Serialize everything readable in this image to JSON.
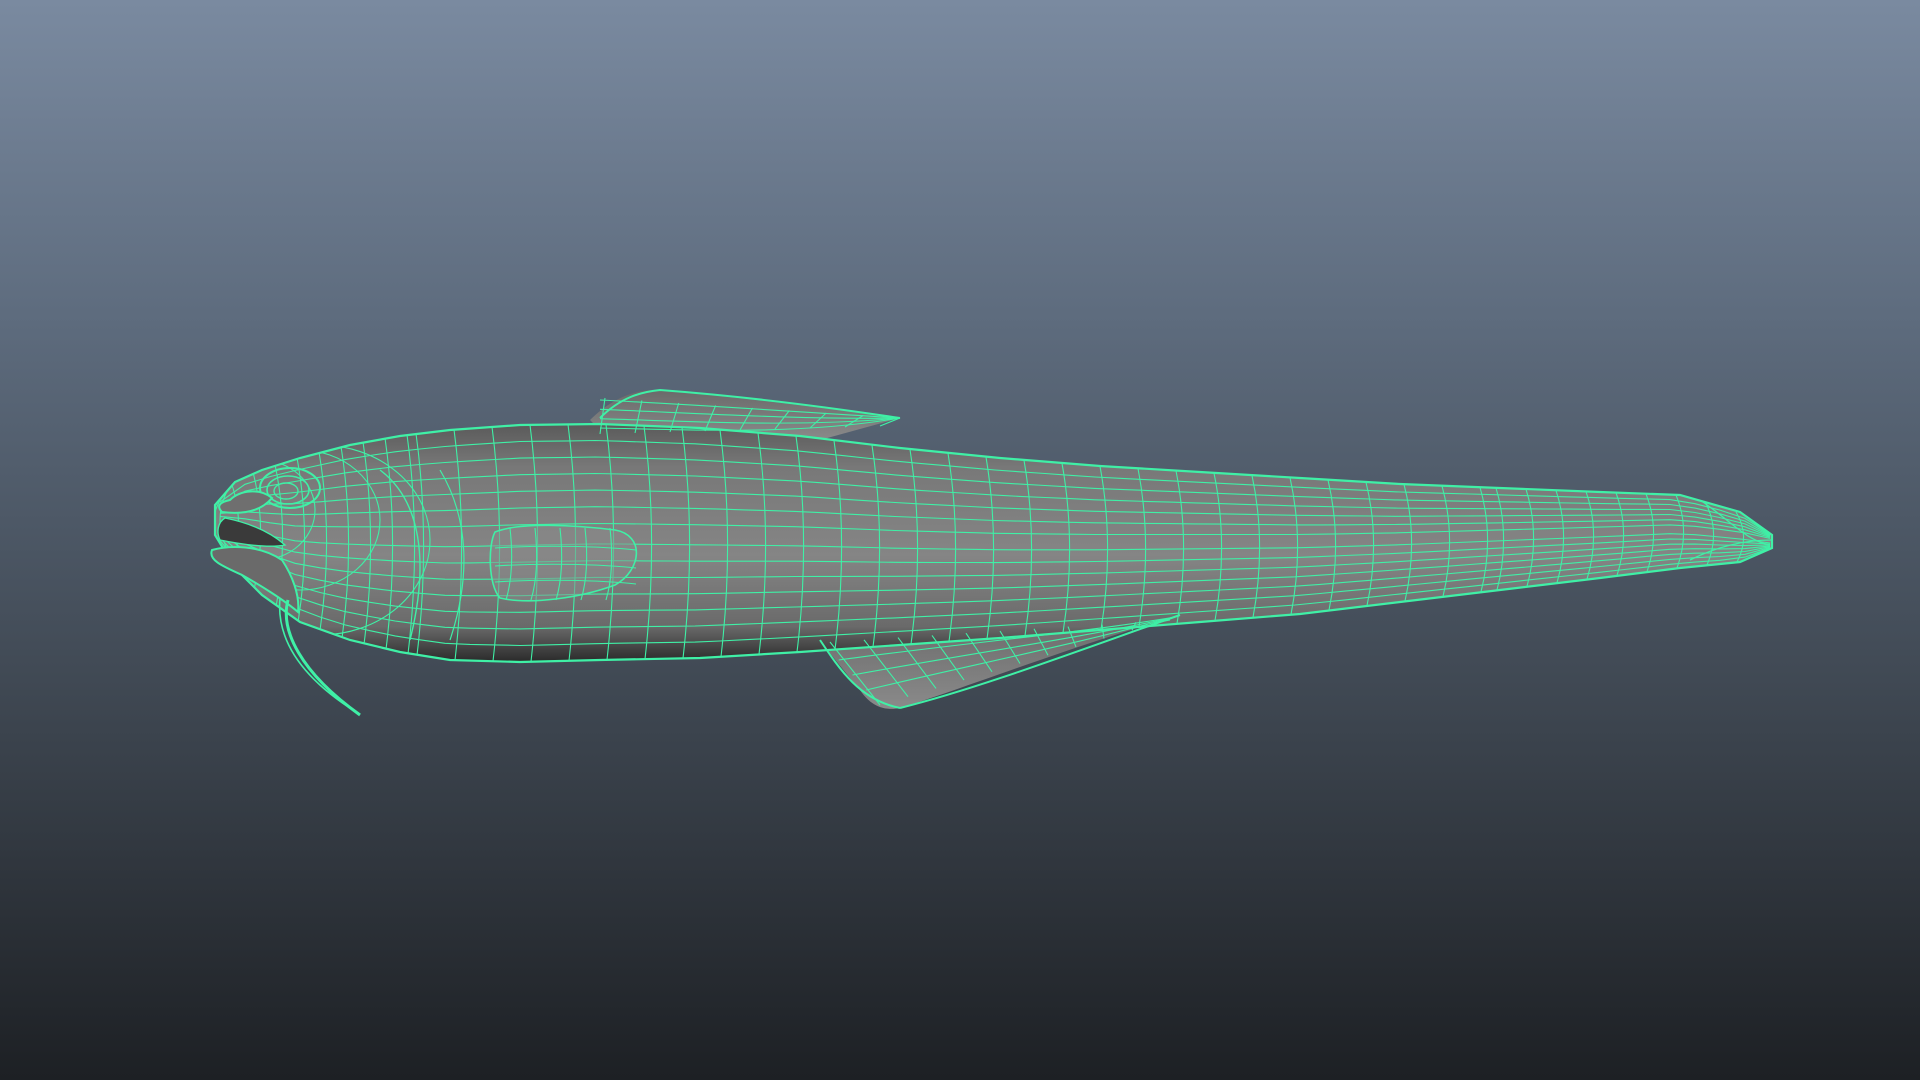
{
  "viewport": {
    "background_top": "#7a8aa0",
    "background_bottom": "#1d2024",
    "wireframe_color": "#3ff0a6",
    "shaded_surface_color": "#7c7c7c"
  },
  "model": {
    "subject": "fish-mesh",
    "display_mode": "wireframe-on-shaded",
    "selected": true
  }
}
